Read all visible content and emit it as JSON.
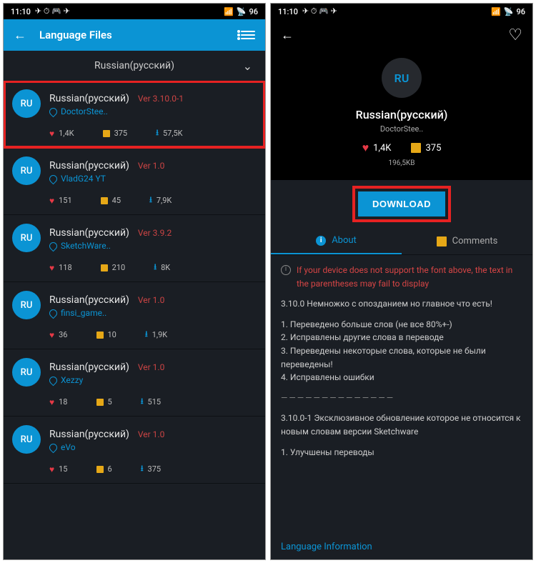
{
  "status": {
    "time": "11:10",
    "battery": "96"
  },
  "left": {
    "title": "Language Files",
    "subheader": "Russian(русский)",
    "items": [
      {
        "title": "Russian(русский)",
        "ver": "Ver 3.10.0-1",
        "author": "DoctorStee..",
        "likes": "1,4K",
        "comments": "375",
        "downloads": "57,5K",
        "highlight": true
      },
      {
        "title": "Russian(русский)",
        "ver": "Ver 1.0",
        "author": "VladG24 YT",
        "likes": "151",
        "comments": "45",
        "downloads": "7,9K",
        "highlight": false
      },
      {
        "title": "Russian(русский)",
        "ver": "Ver 3.9.2",
        "author": "SketchWare..",
        "likes": "118",
        "comments": "210",
        "downloads": "8K",
        "highlight": false
      },
      {
        "title": "Russian(русский)",
        "ver": "Ver 1.0",
        "author": "finsi_game..",
        "likes": "36",
        "comments": "10",
        "downloads": "1,9K",
        "highlight": false
      },
      {
        "title": "Russian(русский)",
        "ver": "Ver 1.0",
        "author": "Xezzy",
        "likes": "18",
        "comments": "5",
        "downloads": "515",
        "highlight": false
      },
      {
        "title": "Russian(русский)",
        "ver": "Ver 1.0",
        "author": "eVo",
        "likes": "15",
        "comments": "6",
        "downloads": "375",
        "highlight": false
      }
    ],
    "avatar_label": "RU"
  },
  "right": {
    "avatar_label": "RU",
    "title": "Russian(русский)",
    "author": "DoctorStee..",
    "likes": "1,4K",
    "comments": "375",
    "size": "196,5KB",
    "download_label": "DOWNLOAD",
    "tabs": {
      "about": "About",
      "comments": "Comments"
    },
    "warning": "If your device does not support the font above, the text in the parentheses may fail to display",
    "body1": "3.10.0 Немножко с опозданием но главное что есть!",
    "body2": "1. Переведено больше слов (не все 80%+-)\n2. Исправлены другие слова в переводе\n3. Переведены некоторые слова, которые не были переведены!\n4. Исправлены ошибки",
    "sep": "——————————————",
    "body3": "3.10.0-1 Эксклюзивное обновление которое не относится к новым словам версии Sketchware",
    "body4": "1. Улучшены переводы",
    "footer": "Language Information"
  }
}
